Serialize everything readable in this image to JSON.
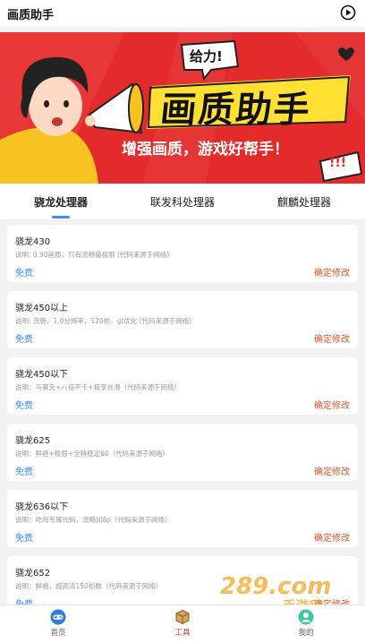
{
  "app": {
    "title": "画质助手"
  },
  "banner": {
    "big_text": "画质助手",
    "slogan": "增强画质，游戏好帮手！",
    "bubble": "给力!",
    "exclaim": "!!!"
  },
  "tabs": [
    {
      "label": "骁龙处理器"
    },
    {
      "label": "联发科处理器"
    },
    {
      "label": "麒麟处理器"
    }
  ],
  "items": [
    {
      "title": "骁龙430",
      "desc": "说明: 0.90画质，只有流畅最极限 (代码来源于网络)",
      "free": "免费",
      "confirm": "确定修改"
    },
    {
      "title": "骁龙450以上",
      "desc": "说明: 流畅，1.0分辨率，120帧，gt优化 (代码来源于网络)",
      "free": "免费",
      "confirm": "确定修改"
    },
    {
      "title": "骁龙450以下",
      "desc": "说明：马赛克+八倍不卡+极享丝滑（代码来源于网络）",
      "free": "免费",
      "confirm": "确定修改"
    },
    {
      "title": "骁龙625",
      "desc": "说明：鲜艳+极限+全特稳定60（代码来源于网络）",
      "free": "免费",
      "confirm": "确定修改"
    },
    {
      "title": "骁龙636以下",
      "desc": "说明：吃鸡专属代码，流畅如8p（代码来源于网络）",
      "free": "免费",
      "confirm": "确定修改"
    },
    {
      "title": "骁龙652",
      "desc": "说明：鲜艳，超高清150帧数（代码来源于网络）",
      "free": "免费",
      "confirm": "确定修改"
    }
  ],
  "nav": [
    {
      "label": "首页"
    },
    {
      "label": "工具"
    },
    {
      "label": "我的"
    }
  ],
  "watermark": {
    "text": "289.com",
    "sub": "手游网"
  },
  "colors": {
    "accent": "#3d8ff5",
    "confirm": "#e0552a",
    "banner_red": "#e32b2b",
    "banner_yellow": "#ffe033"
  }
}
